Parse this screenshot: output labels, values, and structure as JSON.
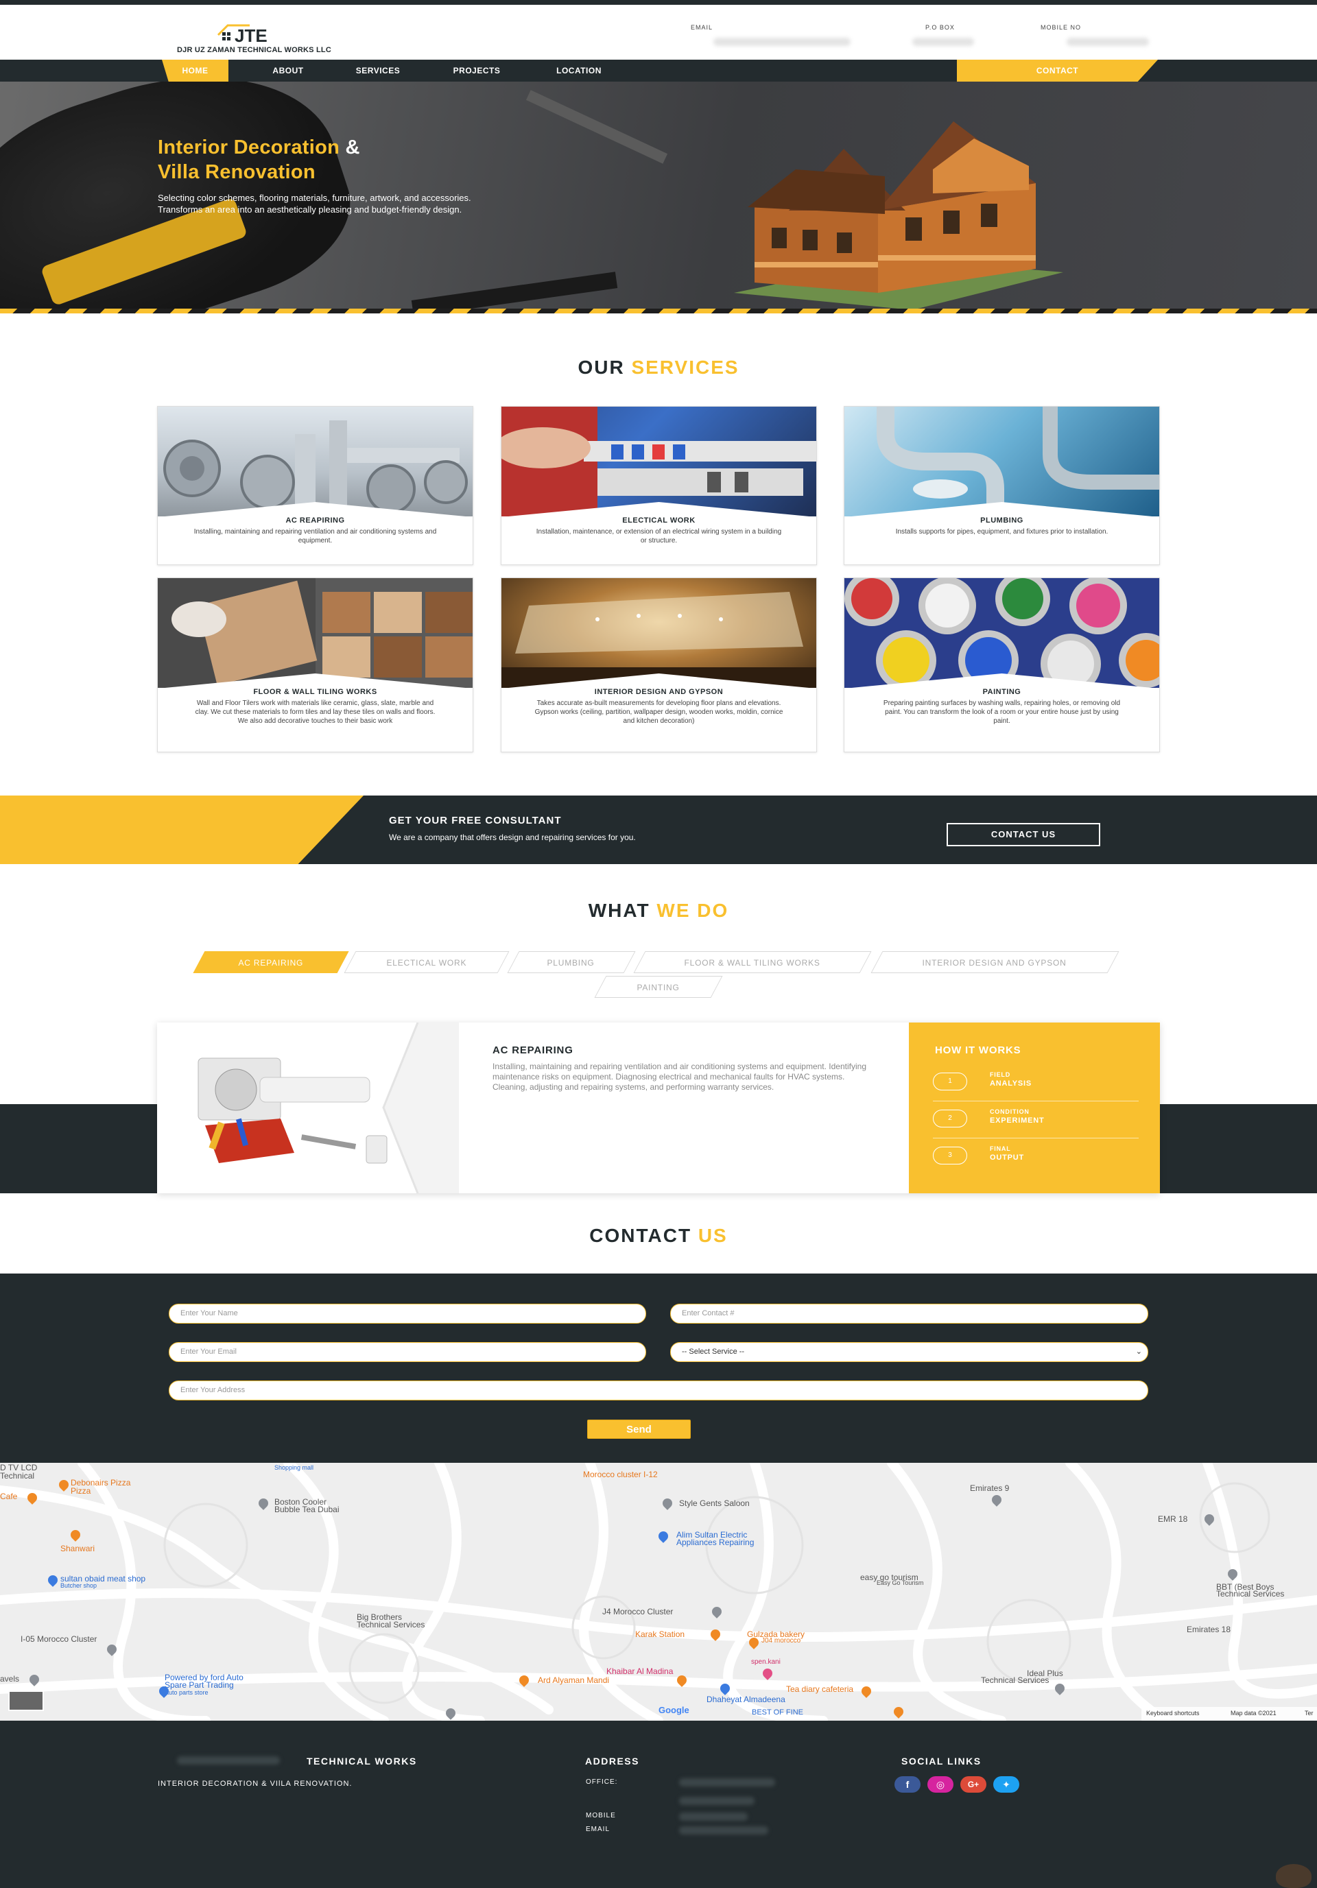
{
  "header": {
    "logo_text": "DJR UZ ZAMAN TECHNICAL WORKS LLC",
    "email_label": "EMAIL",
    "pobox_label": "P.O BOX",
    "mobile_label": "MOBILE NO"
  },
  "nav": {
    "items": [
      "HOME",
      "ABOUT",
      "SERVICES",
      "PROJECTS",
      "LOCATION"
    ],
    "contact": "CONTACT"
  },
  "hero": {
    "title_line1": "Interior Decoration",
    "title_amp": "&",
    "title_line2": "Villa Renovation",
    "subtitle_line1": "Selecting color schemes, flooring materials, furniture, artwork, and accessories.",
    "subtitle_line2": "Transforms an area into an aesthetically pleasing and budget-friendly design."
  },
  "services": {
    "title_a": "OUR",
    "title_b": "SERVICES",
    "cards": [
      {
        "title": "AC REAPIRING",
        "text": "Installing, maintaining and repairing ventilation and air conditioning systems and equipment."
      },
      {
        "title": "ELECTICAL WORK",
        "text": "Installation, maintenance, or extension of an electrical wiring system in a building or structure."
      },
      {
        "title": "PLUMBING",
        "text": "Installs supports for pipes, equipment, and fixtures prior to installation."
      },
      {
        "title": "FLOOR & WALL TILING WORKS",
        "text": "Wall and Floor Tilers work with materials like ceramic, glass, slate, marble and clay. We cut these materials to form tiles and lay these tiles on walls and floors. We also add decorative touches to their basic work"
      },
      {
        "title": "INTERIOR DESIGN AND GYPSON",
        "text": "Takes accurate as-built measurements for developing floor plans and elevations. Gypson works (ceiling, partition, wallpaper design, wooden works, moldin, cornice and kitchen decoration)"
      },
      {
        "title": "PAINTING",
        "text": "Preparing painting surfaces by washing walls, repairing holes, or removing old paint. You can transform the look of a room or your entire house just by using paint."
      }
    ]
  },
  "consult": {
    "title": "GET YOUR FREE CONSULTANT",
    "subtitle": "We are a company that offers design and repairing services for you.",
    "button": "CONTACT US"
  },
  "whatwedo": {
    "title_a": "WHAT",
    "title_b": "WE DO",
    "tabs": [
      "AC REPAIRING",
      "ELECTICAL WORK",
      "PLUMBING",
      "FLOOR & WALL TILING WORKS",
      "INTERIOR DESIGN AND GYPSON",
      "PAINTING"
    ],
    "active_title": "AC REPAIRING",
    "active_text": "Installing, maintaining and repairing ventilation and air conditioning systems and equipment. Identifying maintenance risks on equipment. Diagnosing electrical and mechanical faults for HVAC systems. Cleaning, adjusting and repairing systems, and performing warranty services.",
    "how_title": "HOW IT WORKS",
    "steps": [
      {
        "num": "1",
        "l1": "FIELD",
        "l2": "ANALYSIS"
      },
      {
        "num": "2",
        "l1": "CONDITION",
        "l2": "EXPERIMENT"
      },
      {
        "num": "3",
        "l1": "FINAL",
        "l2": "OUTPUT"
      }
    ]
  },
  "contact": {
    "title_a": "CONTACT",
    "title_b": "US",
    "name_placeholder": "Enter Your Name",
    "contact_placeholder": "Enter Contact #",
    "email_placeholder": "Enter Your Email",
    "service_select": "-- Select Service --",
    "address_placeholder": "Enter Your Address",
    "send": "Send"
  },
  "map": {
    "labels": [
      "D TV LCD",
      "Technical",
      "Debonairs Pizza",
      "Pizza",
      "Cafe",
      "Shopping mall",
      "Morocco cluster I-12",
      "Emirates 9",
      "Boston Cooler",
      "Bubble Tea Dubai",
      "Style Gents Saloon",
      "EMR 18",
      "Shanwari",
      "Alim Sultan Electric",
      "Appliances Repairing",
      "sultan obaid meat shop",
      "Butcher shop",
      "easy go tourism",
      "Easy Go Tourism",
      "BBT (Best Boys",
      "Technical Services",
      "Big Brothers",
      "Technical Services",
      "J4 Morocco Cluster",
      "Emirates 18",
      "I-05 Morocco Cluster",
      "Karak Station",
      "Gulzada bakery",
      "J04 morocco",
      "spen.kani",
      "Khaibar Al Madina",
      "Ideal Plus",
      "Technical Services",
      "Powered by ford Auto",
      "Spare Part Trading",
      "Auto parts store",
      "Ard Alyaman Mandi",
      "Tea diary cafeteria",
      "Dhaheyat Almadeena",
      "BEST OF FINE",
      "avels"
    ],
    "google": "Google",
    "keyboard": "Keyboard shortcuts",
    "mapdata": "Map data ©2021",
    "terms": "Ter"
  },
  "footer": {
    "company_title": "TECHNICAL WORKS",
    "company_tagline": "INTERIOR DECORATION & VIlLA RENOVATION.",
    "address_title": "ADDRESS",
    "office_label": "OFFICE:",
    "mobile_label": "MOBILE",
    "email_label": "EMAIL",
    "social_title": "SOCIAL LINKS",
    "social": [
      {
        "icon": "facebook-icon",
        "glyph": "f",
        "color": "#3b5998"
      },
      {
        "icon": "instagram-icon",
        "glyph": "◎",
        "color": "#d6249f"
      },
      {
        "icon": "google-plus-icon",
        "glyph": "G+",
        "color": "#dd4b39"
      },
      {
        "icon": "twitter-icon",
        "glyph": "✦",
        "color": "#1da1f2"
      }
    ]
  },
  "colors": {
    "accent": "#f9c02f",
    "dark": "#232b2e"
  }
}
